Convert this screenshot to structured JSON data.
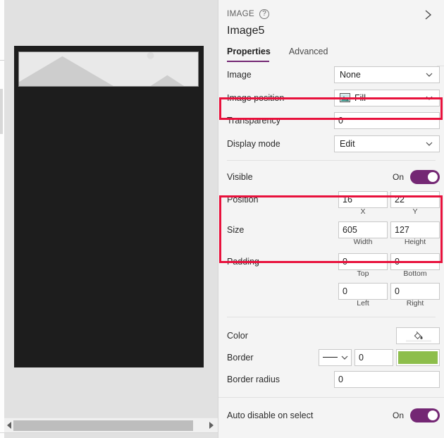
{
  "canvas": {
    "name": "app-canvas",
    "screen_bg": "#1d1d1d",
    "image_placeholder_name": "image-placeholder-mountains",
    "scrollbar_left_arrow": "left-arrow",
    "scrollbar_right_arrow": "right-arrow"
  },
  "panel": {
    "kicker": "IMAGE",
    "help_icon": "help-icon",
    "collapse_icon": "chevron-right-icon",
    "control_name": "Image5",
    "tabs": [
      {
        "label": "Properties",
        "active": true
      },
      {
        "label": "Advanced",
        "active": false
      }
    ],
    "properties": [
      {
        "label": "Image",
        "type": "dropdown",
        "value": "None",
        "icon": null
      },
      {
        "label": "Image position",
        "type": "dropdown",
        "value": "Fill",
        "icon": "picture-icon",
        "highlighted": true
      },
      {
        "label": "Transparency",
        "type": "text",
        "value": "0"
      },
      {
        "label": "Display mode",
        "type": "dropdown",
        "value": "Edit",
        "icon": null
      }
    ],
    "visible": {
      "label": "Visible",
      "state": "On",
      "on": true
    },
    "position": {
      "label": "Position",
      "x": "16",
      "y": "22",
      "x_sublabel": "X",
      "y_sublabel": "Y"
    },
    "size": {
      "label": "Size",
      "width": "605",
      "height": "127",
      "width_sublabel": "Width",
      "height_sublabel": "Height"
    },
    "padding": {
      "label": "Padding",
      "top": "0",
      "bottom": "0",
      "left": "0",
      "right": "0",
      "top_sublabel": "Top",
      "bottom_sublabel": "Bottom",
      "left_sublabel": "Left",
      "right_sublabel": "Right"
    },
    "color": {
      "label": "Color",
      "icon": "paint-bucket-icon"
    },
    "border": {
      "label": "Border",
      "style_icon": "solid-line-icon",
      "thickness": "0",
      "color_swatch": "#8dbe4b"
    },
    "border_radius": {
      "label": "Border radius",
      "value": "0"
    },
    "auto_disable": {
      "label": "Auto disable on select",
      "state": "On",
      "on": true
    },
    "accent_color": "#742774",
    "highlight_color": "#e8113c"
  }
}
